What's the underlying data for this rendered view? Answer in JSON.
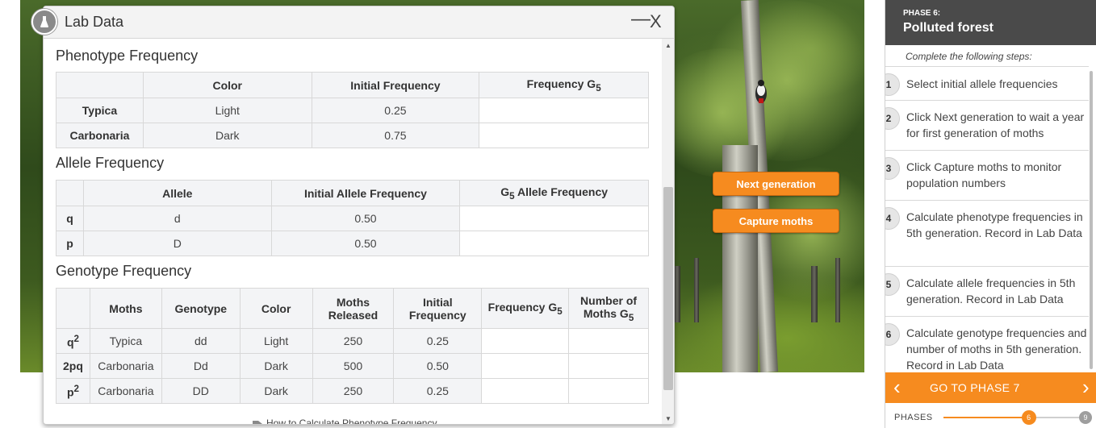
{
  "window": {
    "title": "Lab Data",
    "minimize": "—",
    "close": "X"
  },
  "phenotype": {
    "title": "Phenotype Frequency",
    "headers": [
      "",
      "Color",
      "Initial Frequency",
      "Frequency G5"
    ],
    "rows": [
      {
        "name": "Typica",
        "color": "Light",
        "initial": "0.25",
        "g5": ""
      },
      {
        "name": "Carbonaria",
        "color": "Dark",
        "initial": "0.75",
        "g5": ""
      }
    ]
  },
  "allele": {
    "title": "Allele Frequency",
    "headers": [
      "",
      "Allele",
      "Initial Allele Frequency",
      "G5 Allele Frequency"
    ],
    "rows": [
      {
        "symbol": "q",
        "allele": "d",
        "initial": "0.50",
        "g5": ""
      },
      {
        "symbol": "p",
        "allele": "D",
        "initial": "0.50",
        "g5": ""
      }
    ]
  },
  "genotype": {
    "title": "Genotype Frequency",
    "headers": [
      "",
      "Moths",
      "Genotype",
      "Color",
      "Moths Released",
      "Initial Frequency",
      "Frequency G5",
      "Number of Moths G5"
    ],
    "rows": [
      {
        "symbol": "q2",
        "moths": "Typica",
        "genotype": "dd",
        "color": "Light",
        "released": "250",
        "initial": "0.25",
        "freq_g5": "",
        "num_g5": ""
      },
      {
        "symbol": "2pq",
        "moths": "Carbonaria",
        "genotype": "Dd",
        "color": "Dark",
        "released": "500",
        "initial": "0.50",
        "freq_g5": "",
        "num_g5": ""
      },
      {
        "symbol": "p2",
        "moths": "Carbonaria",
        "genotype": "DD",
        "color": "Dark",
        "released": "250",
        "initial": "0.25",
        "freq_g5": "",
        "num_g5": ""
      }
    ]
  },
  "howto_link": "How to Calculate Phenotype Frequency",
  "buttons": {
    "next_generation": "Next generation",
    "capture_moths": "Capture moths"
  },
  "panel": {
    "phase_label": "PHASE 6:",
    "phase_name": "Polluted forest",
    "steps_intro": "Complete the following steps:",
    "steps": [
      {
        "num": "1",
        "text": "Select initial allele frequencies"
      },
      {
        "num": "2",
        "text": "Click Next generation to wait a year for first generation of moths"
      },
      {
        "num": "3",
        "text": "Click Capture moths to monitor population numbers"
      },
      {
        "num": "4",
        "text": "Calculate phenotype frequencies in 5th generation. Record in Lab Data"
      },
      {
        "num": "5",
        "text": "Calculate allele frequencies in 5th generation. Record in Lab Data"
      },
      {
        "num": "6",
        "text": "Calculate genotype frequencies and number of moths in 5th generation. Record in Lab Data"
      }
    ],
    "goto_label": "GO TO PHASE 7",
    "phases_label": "PHASES",
    "phase_current": "6",
    "phase_total": "9",
    "phase_progress": 0.6,
    "accent": "#f68b1f"
  }
}
